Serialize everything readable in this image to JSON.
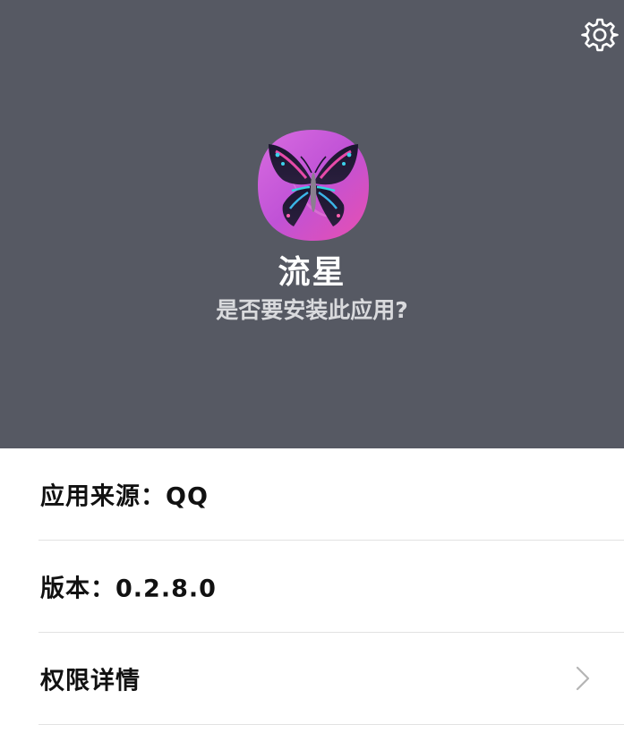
{
  "header": {
    "background_color": "#565963",
    "settings_icon": "gear-icon",
    "app_icon": "butterfly-app-icon",
    "app_name": "流星",
    "install_question": "是否要安装此应用?"
  },
  "info": {
    "source_label": "应用来源：",
    "source_value": "QQ",
    "version_label": "版本：",
    "version_value": "0.2.8.0",
    "permissions_label": "权限详情",
    "permissions_icon": "chevron-right-icon"
  }
}
